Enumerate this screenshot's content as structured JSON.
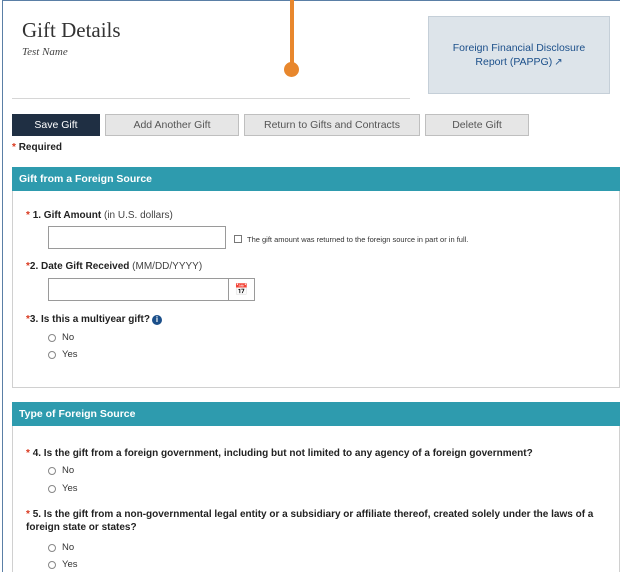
{
  "header": {
    "title": "Gift Details",
    "subtitle": "Test Name",
    "report_link": "Foreign Financial Disclosure Report (PAPPG)",
    "report_link_icon": "external-link-icon"
  },
  "toolbar": {
    "save": "Save Gift",
    "add_another": "Add Another Gift",
    "return": "Return to Gifts and Contracts",
    "delete": "Delete Gift"
  },
  "required_note": "Required",
  "section1": {
    "title": "Gift from a Foreign Source",
    "q1": {
      "number_label": "1. Gift Amount",
      "hint": "(in U.S. dollars)",
      "value": "",
      "checkbox_label": "The gift amount was returned to the foreign source in part or in full."
    },
    "q2": {
      "number_label": "2. Date Gift Received",
      "hint": "(MM/DD/YYYY)",
      "value": "",
      "icon": "calendar-icon"
    },
    "q3": {
      "label": "3. Is this a multiyear gift?",
      "icon": "info-icon",
      "options": [
        "No",
        "Yes"
      ]
    }
  },
  "section2": {
    "title": "Type of Foreign Source",
    "q4": {
      "label": "4. Is the gift from a foreign government, including but not limited to any agency of a foreign government?",
      "options": [
        "No",
        "Yes"
      ]
    },
    "q5": {
      "label": "5. Is the gift from a non-governmental legal entity or a subsidiary or affiliate thereof, created solely under the laws of a foreign state or states?",
      "options": [
        "No",
        "Yes"
      ]
    }
  },
  "colors": {
    "primary_button": "#1f2f43",
    "section_header": "#2e9bae",
    "required_star": "#d9381e",
    "link": "#1b4f8a",
    "pointer": "#e8872d"
  }
}
